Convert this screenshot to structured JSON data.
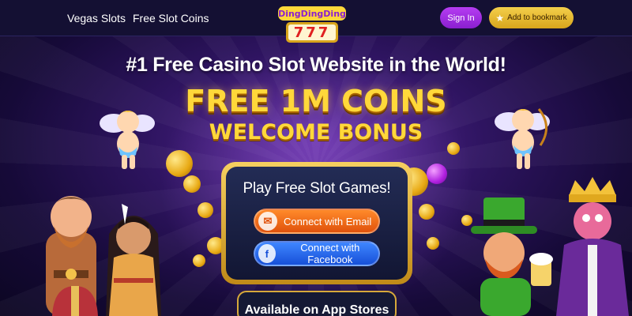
{
  "header": {
    "nav": [
      {
        "label": "Vegas Slots"
      },
      {
        "label": "Free Slot Coins"
      }
    ],
    "logo": {
      "line1": "DingDingDing",
      "line2": "777"
    },
    "signin_label": "Sign In",
    "bookmark_label": "Add to bookmark",
    "bookmark_icon": "star-icon"
  },
  "hero": {
    "tagline": "#1 Free Casino Slot Website in the World!",
    "headline": "FREE 1M COINS",
    "subheadline": "WELCOME BONUS"
  },
  "panel": {
    "title": "Play Free Slot Games!",
    "email_button": {
      "label": "Connect with Email",
      "icon": "envelope-icon"
    },
    "facebook_button": {
      "label": "Connect with Facebook",
      "icon": "facebook-icon",
      "icon_glyph": "f"
    },
    "stores_label": "Available on App Stores"
  },
  "colors": {
    "accent_purple": "#9b2fe0",
    "accent_gold": "#f4cf4b",
    "email_orange": "#f06a18",
    "facebook_blue": "#2b6cf0"
  }
}
